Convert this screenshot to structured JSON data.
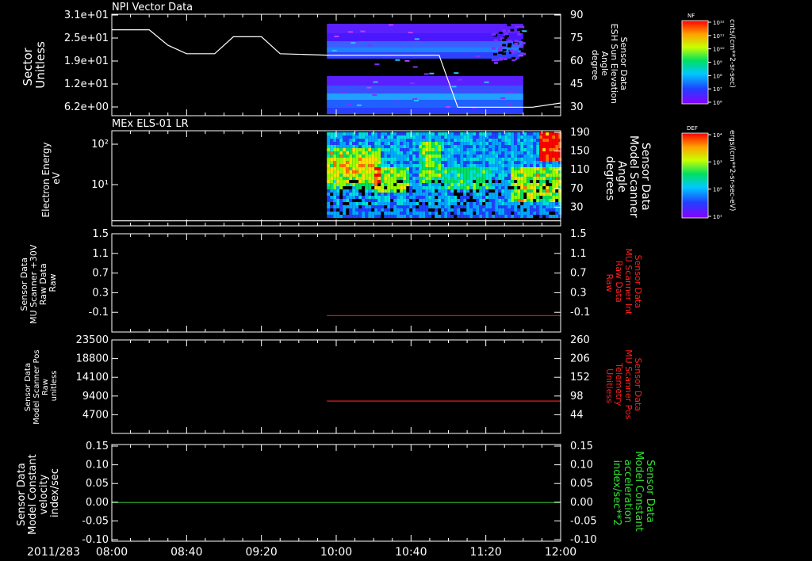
{
  "panels": [
    {
      "id": "npi",
      "title": "NPI Vector Data",
      "type": "spectrogram",
      "left_axis": {
        "label_lines": [
          "Sector",
          "Unitless"
        ],
        "ticks": [
          "3.1e+01",
          "2.5e+01",
          "1.9e+01",
          "1.2e+01",
          "6.2e+00"
        ]
      },
      "right_axis": {
        "label_lines": [
          "Sensor Data",
          "ESH Sun Elevation",
          "Angle",
          "degree"
        ],
        "ticks": [
          "90",
          "75",
          "60",
          "45",
          "30"
        ],
        "color": "#ffffff"
      },
      "colorbar": {
        "label": "NF",
        "unit": "cnts/(cm**2-sr-sec)",
        "ticks": [
          "10¹²",
          "10¹¹",
          "10¹⁰",
          "10⁹",
          "10⁸",
          "10⁷",
          "10⁶"
        ]
      },
      "data_start": "09:55",
      "data_end": "11:40",
      "overlay_line": {
        "name": "ESH Sun Elevation Angle",
        "points": [
          [
            "08:00",
            79
          ],
          [
            "08:20",
            79
          ],
          [
            "08:30",
            68
          ],
          [
            "08:40",
            62
          ],
          [
            "08:55",
            62
          ],
          [
            "09:05",
            74
          ],
          [
            "09:20",
            74
          ],
          [
            "09:30",
            62
          ],
          [
            "09:55",
            61
          ],
          [
            "10:55",
            61
          ],
          [
            "11:05",
            24
          ],
          [
            "11:45",
            24
          ],
          [
            "12:00",
            27
          ]
        ]
      }
    },
    {
      "id": "els",
      "title": "MEx ELS-01 LR",
      "type": "spectrogram",
      "left_axis": {
        "label_lines": [
          "Electron Energy",
          "eV"
        ],
        "ticks": [
          "10²",
          "10¹"
        ]
      },
      "right_axis": {
        "label_lines": [
          "Sensor Data",
          "Model Scanner",
          "Angle",
          "degrees"
        ],
        "ticks": [
          "190",
          "150",
          "110",
          "70",
          "30"
        ],
        "color": "#ffffff"
      },
      "colorbar": {
        "label": "DEF",
        "unit": "ergs/(cm**2-sr-sec-eV)",
        "ticks": [
          "10⁴",
          "10³",
          "10²",
          "10¹"
        ]
      },
      "data_start": "09:55",
      "data_end": "12:00",
      "overlay_line": {
        "name": "Model Scanner Angle",
        "points": [
          [
            "08:00",
            10
          ],
          [
            "12:00",
            10
          ]
        ]
      }
    },
    {
      "id": "int",
      "type": "line",
      "left_axis": {
        "label_lines": [
          "Sensor Data",
          "MU Scanner +30V",
          "Raw Data",
          "Raw"
        ],
        "ticks": [
          "1.5",
          "1.1",
          "0.7",
          "0.3",
          "-0.1"
        ]
      },
      "right_axis": {
        "label_lines": [
          "Sensor Data",
          "MU Scanner Int",
          "Raw Data",
          "Raw"
        ],
        "ticks": [
          "1.5",
          "1.1",
          "0.7",
          "0.3",
          "-0.1"
        ],
        "color": "#ff2020"
      }
    },
    {
      "id": "pos",
      "type": "line",
      "left_axis": {
        "label_lines": [
          "Sensor Data",
          "Model Scanner Pos",
          "Raw",
          "unitless"
        ],
        "ticks": [
          "23500",
          "18800",
          "14100",
          "9400",
          "4700"
        ]
      },
      "right_axis": {
        "label_lines": [
          "Sensor Data",
          "MU Scanner Pos",
          "Telemetry",
          "Unitless"
        ],
        "ticks": [
          "260",
          "206",
          "152",
          "98",
          "44"
        ],
        "color": "#ff2020"
      }
    },
    {
      "id": "vel",
      "type": "line",
      "left_axis": {
        "label_lines": [
          "Sensor Data",
          "Model Constant",
          "velocity",
          "index/sec"
        ],
        "ticks": [
          "0.15",
          "0.10",
          "0.05",
          "0.00",
          "-0.05",
          "-0.10"
        ]
      },
      "right_axis": {
        "label_lines": [
          "Sensor Data",
          "Model Constant",
          "acceleration",
          "index/sec**2"
        ],
        "ticks": [
          "0.15",
          "0.10",
          "0.05",
          "0.00",
          "-0.05",
          "-0.10"
        ],
        "color": "#30e030"
      }
    }
  ],
  "x_axis": {
    "date_label": "2011/283",
    "ticks": [
      "08:00",
      "08:40",
      "09:20",
      "10:00",
      "10:40",
      "11:20",
      "12:00"
    ]
  },
  "chart_data": [
    {
      "type": "heatmap",
      "title": "NPI Vector Data",
      "x_range": [
        "08:00",
        "12:00"
      ],
      "ylabel": "Sector Unitless",
      "y_ticks": [
        "3.1e+01",
        "2.5e+01",
        "1.9e+01",
        "1.2e+01",
        "6.2e+00"
      ],
      "colorbar_label": "NF",
      "colorbar_unit": "cnts/(cm**2-sr-sec)",
      "coverage": [
        "09:55",
        "11:40"
      ],
      "series": [
        {
          "name": "ESH Sun Elevation Angle",
          "x": [
            "08:00",
            "08:20",
            "08:30",
            "08:40",
            "08:55",
            "09:05",
            "09:20",
            "09:30",
            "09:55",
            "10:55",
            "11:05",
            "11:45",
            "12:00"
          ],
          "y": [
            79,
            79,
            68,
            62,
            62,
            74,
            74,
            62,
            61,
            61,
            24,
            24,
            27
          ]
        }
      ],
      "y2label": "Sensor Data ESH Sun Elevation Angle degree",
      "y2lim": [
        18,
        90
      ]
    },
    {
      "type": "heatmap",
      "title": "MEx ELS-01 LR",
      "x_range": [
        "08:00",
        "12:00"
      ],
      "ylabel": "Electron Energy eV",
      "y_ticks": [
        "10²",
        "10¹"
      ],
      "colorbar_label": "DEF",
      "colorbar_unit": "ergs/(cm**2-sr-sec-eV)",
      "coverage": [
        "09:55",
        "12:00"
      ],
      "series": [
        {
          "name": "Model Scanner Angle",
          "x": [
            "08:00",
            "12:00"
          ],
          "y": [
            10,
            10
          ]
        }
      ],
      "y2label": "Sensor Data Model Scanner Angle degrees",
      "y2lim": [
        0,
        190
      ]
    },
    {
      "type": "line",
      "x_range": [
        "08:00",
        "12:00"
      ],
      "ylabel": "Sensor Data MU Scanner +30V Raw Data Raw",
      "ylim": [
        -0.3,
        1.5
      ],
      "y2label": "Sensor Data MU Scanner Int Raw Data Raw",
      "y2lim": [
        -0.3,
        1.5
      ],
      "series": [
        {
          "name": "MU Scanner Int",
          "axis": "right",
          "x": [
            "09:55",
            "12:00"
          ],
          "y": [
            0.0,
            0.0
          ]
        }
      ]
    },
    {
      "type": "line",
      "x_range": [
        "08:00",
        "12:00"
      ],
      "ylabel": "Sensor Data Model Scanner Pos Raw unitless",
      "ylim": [
        0,
        23500
      ],
      "y2label": "Sensor Data MU Scanner Pos Telemetry Unitless",
      "y2lim": [
        0,
        260
      ],
      "series": [
        {
          "name": "MU Scanner Pos",
          "axis": "right",
          "x": [
            "09:55",
            "12:00"
          ],
          "y": [
            90,
            90
          ]
        }
      ]
    },
    {
      "type": "line",
      "x_range": [
        "08:00",
        "12:00"
      ],
      "ylabel": "Sensor Data Model Constant velocity index/sec",
      "ylim": [
        -0.1,
        0.15
      ],
      "y2label": "Sensor Data Model Constant acceleration index/sec**2",
      "y2lim": [
        -0.1,
        0.15
      ],
      "series": [
        {
          "name": "Model Constant velocity",
          "axis": "left",
          "x": [
            "08:00",
            "12:00"
          ],
          "y": [
            0.0,
            0.0
          ]
        }
      ]
    }
  ]
}
